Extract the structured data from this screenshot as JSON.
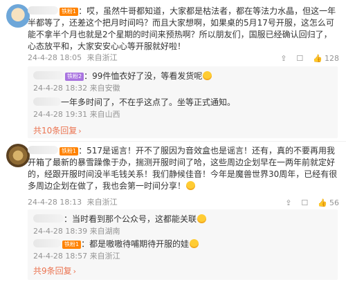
{
  "comments": [
    {
      "badge": "铁粉1",
      "text": "：哎，虽然牛哥都知道，大家都是枯法者，都在等法力水晶，但这一年半都等了，还差这个把月时间吗？而且大家想啊，如果桌的5月17号开服，这怎么可能不拿半个月也就是2个星期的时间来预热啊？所以朋友们，国服已经确认回归了，心态放平和，大家安安心心等开服就好啦！",
      "date": "24-4-28 18:05",
      "location": "来自浙江",
      "like_count": "128",
      "replies": [
        {
          "badge": "铁粉2",
          "text": "：99件恤衣好了没，等看发货呢",
          "date": "24-4-28 18:32",
          "location": "来自安徽"
        },
        {
          "badge": "",
          "text": "一年多时间了，不在乎这点了。坐等正式通知。",
          "date": "24-4-28 19:31",
          "location": "来自山西"
        }
      ],
      "more": "共10条回复"
    },
    {
      "badge": "铁粉1",
      "text": "：517是谣言！开不了服因为音效盒也是谣言！还有，真的不要再用我开箱了最新的暴雪躁像于办，揣测开服时间了哈，这些周边企划早在一两年前就定好的，经跟开服时间没半毛钱关系！我们静候佳音！今年是魔兽世界30周年，已经有很多周边企划在做了，我也会第一时间分享！",
      "date": "24-4-28 18:13",
      "location": "来自浙江",
      "like_count": "56",
      "replies": [
        {
          "badge": "",
          "text": "：当时看到那个公众号，这都能关联",
          "date": "24-4-28 18:39",
          "location": "来自湖南"
        },
        {
          "badge": "铁粉1",
          "text": "：都是嗷嗷待哺期待开服的娃",
          "date": "24-4-28 18:57",
          "location": "来自浙江"
        }
      ],
      "more": "共9条回复"
    }
  ],
  "icons": {
    "share": "share-icon",
    "comment": "comment-icon",
    "like": "like-icon",
    "more": "chevron-right-icon"
  }
}
